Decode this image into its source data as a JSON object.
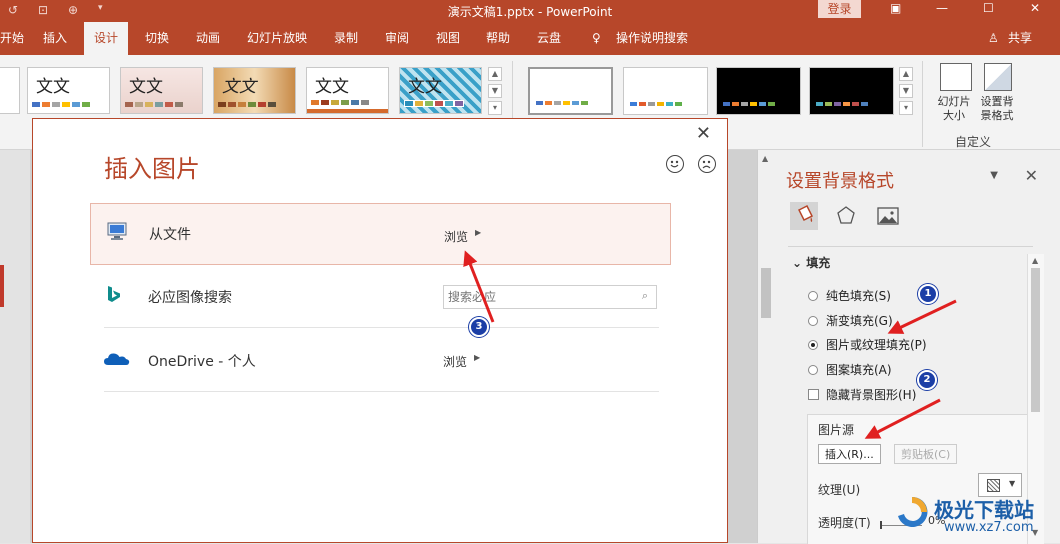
{
  "titlebar": {
    "doc_title": "演示文稿1.pptx  -  PowerPoint",
    "login_label": "登录",
    "minimize": "—",
    "restore": "☐",
    "close": "✕"
  },
  "menu": {
    "tabs": [
      "开始",
      "插入",
      "设计",
      "切换",
      "动画",
      "幻灯片放映",
      "录制",
      "审阅",
      "视图",
      "帮助",
      "云盘",
      "操作说明搜索"
    ],
    "active_tab": "设计",
    "share_label": "共享"
  },
  "ribbon": {
    "theme_text": "文文",
    "themes": [
      {
        "label": "文文",
        "style": "plain"
      },
      {
        "label": "文文",
        "style": "pink"
      },
      {
        "label": "文文",
        "style": "wood"
      },
      {
        "label": "文文",
        "style": "plain2"
      },
      {
        "label": "文文",
        "style": "pattern"
      }
    ],
    "slide_size_label": "幻灯片大小",
    "bg_format_label": "设置背景格式",
    "custom_group_label": "自定义"
  },
  "dialog": {
    "title": "插入图片",
    "close": "✕",
    "rows": {
      "file_label": "从文件",
      "file_browse": "浏览",
      "bing_label": "必应图像搜索",
      "bing_placeholder": "搜索必应",
      "onedrive_label": "OneDrive - 个人",
      "onedrive_browse": "浏览"
    }
  },
  "format_pane": {
    "title": "设置背景格式",
    "fill_header": "填充",
    "options": [
      {
        "label": "纯色填充(S)",
        "selected": false
      },
      {
        "label": "渐变填充(G)",
        "selected": false
      },
      {
        "label": "图片或纹理填充(P)",
        "selected": true
      },
      {
        "label": "图案填充(A)",
        "selected": false
      }
    ],
    "hide_bg_label": "隐藏背景图形(H)",
    "picture_source_label": "图片源",
    "insert_button": "插入(R)...",
    "clipboard_button": "剪贴板(C)",
    "texture_label": "纹理(U)",
    "transparency_label": "透明度(T)",
    "transparency_value": "0%"
  },
  "annotations": {
    "badge_1": "1",
    "badge_2": "2",
    "badge_3": "3"
  },
  "watermark": {
    "cn": "极光下载站",
    "url": "www.xz7.com"
  },
  "colors": {
    "accent": "#b7472a",
    "arrow": "#e02020",
    "badge": "#1b3ea6"
  }
}
